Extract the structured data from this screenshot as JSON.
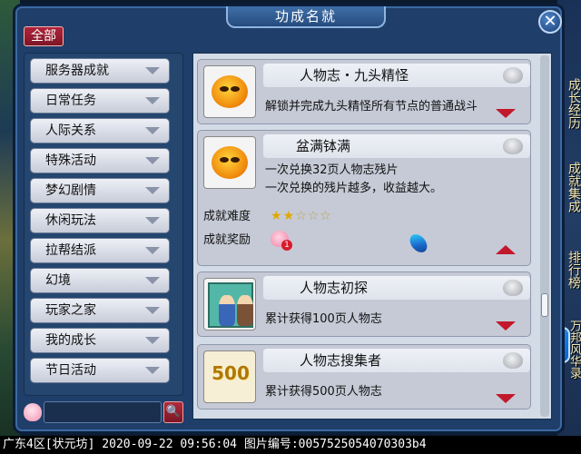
{
  "window": {
    "title": "功成名就",
    "close_glyph": "✕",
    "all_button": "全部"
  },
  "side_tabs": [
    "成长经历",
    "成就集成",
    "排行榜",
    "万邦风华录"
  ],
  "logo_glyph": "梦",
  "sidebar": {
    "items": [
      {
        "label": "服务器成就"
      },
      {
        "label": "日常任务"
      },
      {
        "label": "人际关系"
      },
      {
        "label": "特殊活动"
      },
      {
        "label": "梦幻剧情"
      },
      {
        "label": "休闲玩法"
      },
      {
        "label": "拉帮结派"
      },
      {
        "label": "幻境"
      },
      {
        "label": "玩家之家"
      },
      {
        "label": "我的成长"
      },
      {
        "label": "节日活动"
      }
    ],
    "search_icon": "🔍"
  },
  "achievements": [
    {
      "name": "人物志・九头精怪",
      "desc": "解锁并完成九头精怪所有节点的普通战斗",
      "icon": "angry-orange-face-icon",
      "expanded": false
    },
    {
      "name": "盆满钵满",
      "desc_line1": "一次兑换32页人物志残片",
      "desc_line2": "一次兑换的残片越多，收益越大。",
      "difficulty_label": "成就难度",
      "difficulty_stars": 2,
      "difficulty_max": 5,
      "reward_label": "成就奖励",
      "reward_badge": "1",
      "icon": "angry-orange-face-icon",
      "expanded": true
    },
    {
      "name": "人物志初探",
      "desc": "累计获得100页人物志",
      "icon": "two-monks-icon",
      "expanded": false
    },
    {
      "name": "人物志搜集者",
      "desc": "累计获得500页人物志",
      "icon_text": "500",
      "expanded": false
    }
  ],
  "status_bar": "广东4区[状元坊] 2020-09-22 09:56:04 图片编号:0057525054070303b4"
}
